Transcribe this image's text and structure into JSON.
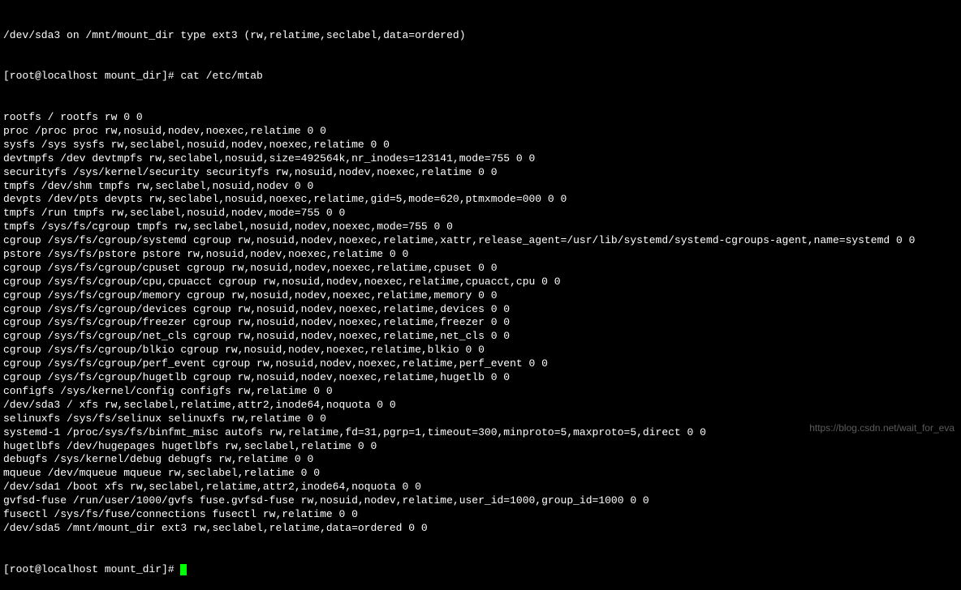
{
  "terminal": {
    "partial_top": "/dev/sda3 on /mnt/mount_dir type ext3 (rw,relatime,seclabel,data=ordered)",
    "prompt1": "[root@localhost mount_dir]# ",
    "command1": "cat /etc/mtab",
    "output_lines": [
      "rootfs / rootfs rw 0 0",
      "proc /proc proc rw,nosuid,nodev,noexec,relatime 0 0",
      "sysfs /sys sysfs rw,seclabel,nosuid,nodev,noexec,relatime 0 0",
      "devtmpfs /dev devtmpfs rw,seclabel,nosuid,size=492564k,nr_inodes=123141,mode=755 0 0",
      "securityfs /sys/kernel/security securityfs rw,nosuid,nodev,noexec,relatime 0 0",
      "tmpfs /dev/shm tmpfs rw,seclabel,nosuid,nodev 0 0",
      "devpts /dev/pts devpts rw,seclabel,nosuid,noexec,relatime,gid=5,mode=620,ptmxmode=000 0 0",
      "tmpfs /run tmpfs rw,seclabel,nosuid,nodev,mode=755 0 0",
      "tmpfs /sys/fs/cgroup tmpfs rw,seclabel,nosuid,nodev,noexec,mode=755 0 0",
      "cgroup /sys/fs/cgroup/systemd cgroup rw,nosuid,nodev,noexec,relatime,xattr,release_agent=/usr/lib/systemd/systemd-cgroups-agent,name=systemd 0 0",
      "pstore /sys/fs/pstore pstore rw,nosuid,nodev,noexec,relatime 0 0",
      "cgroup /sys/fs/cgroup/cpuset cgroup rw,nosuid,nodev,noexec,relatime,cpuset 0 0",
      "cgroup /sys/fs/cgroup/cpu,cpuacct cgroup rw,nosuid,nodev,noexec,relatime,cpuacct,cpu 0 0",
      "cgroup /sys/fs/cgroup/memory cgroup rw,nosuid,nodev,noexec,relatime,memory 0 0",
      "cgroup /sys/fs/cgroup/devices cgroup rw,nosuid,nodev,noexec,relatime,devices 0 0",
      "cgroup /sys/fs/cgroup/freezer cgroup rw,nosuid,nodev,noexec,relatime,freezer 0 0",
      "cgroup /sys/fs/cgroup/net_cls cgroup rw,nosuid,nodev,noexec,relatime,net_cls 0 0",
      "cgroup /sys/fs/cgroup/blkio cgroup rw,nosuid,nodev,noexec,relatime,blkio 0 0",
      "cgroup /sys/fs/cgroup/perf_event cgroup rw,nosuid,nodev,noexec,relatime,perf_event 0 0",
      "cgroup /sys/fs/cgroup/hugetlb cgroup rw,nosuid,nodev,noexec,relatime,hugetlb 0 0",
      "configfs /sys/kernel/config configfs rw,relatime 0 0",
      "/dev/sda3 / xfs rw,seclabel,relatime,attr2,inode64,noquota 0 0",
      "selinuxfs /sys/fs/selinux selinuxfs rw,relatime 0 0",
      "systemd-1 /proc/sys/fs/binfmt_misc autofs rw,relatime,fd=31,pgrp=1,timeout=300,minproto=5,maxproto=5,direct 0 0",
      "hugetlbfs /dev/hugepages hugetlbfs rw,seclabel,relatime 0 0",
      "debugfs /sys/kernel/debug debugfs rw,relatime 0 0",
      "mqueue /dev/mqueue mqueue rw,seclabel,relatime 0 0",
      "/dev/sda1 /boot xfs rw,seclabel,relatime,attr2,inode64,noquota 0 0",
      "gvfsd-fuse /run/user/1000/gvfs fuse.gvfsd-fuse rw,nosuid,nodev,relatime,user_id=1000,group_id=1000 0 0",
      "fusectl /sys/fs/fuse/connections fusectl rw,relatime 0 0",
      "/dev/sda5 /mnt/mount_dir ext3 rw,seclabel,relatime,data=ordered 0 0"
    ],
    "prompt2": "[root@localhost mount_dir]# "
  },
  "watermark": "https://blog.csdn.net/wait_for_eva"
}
